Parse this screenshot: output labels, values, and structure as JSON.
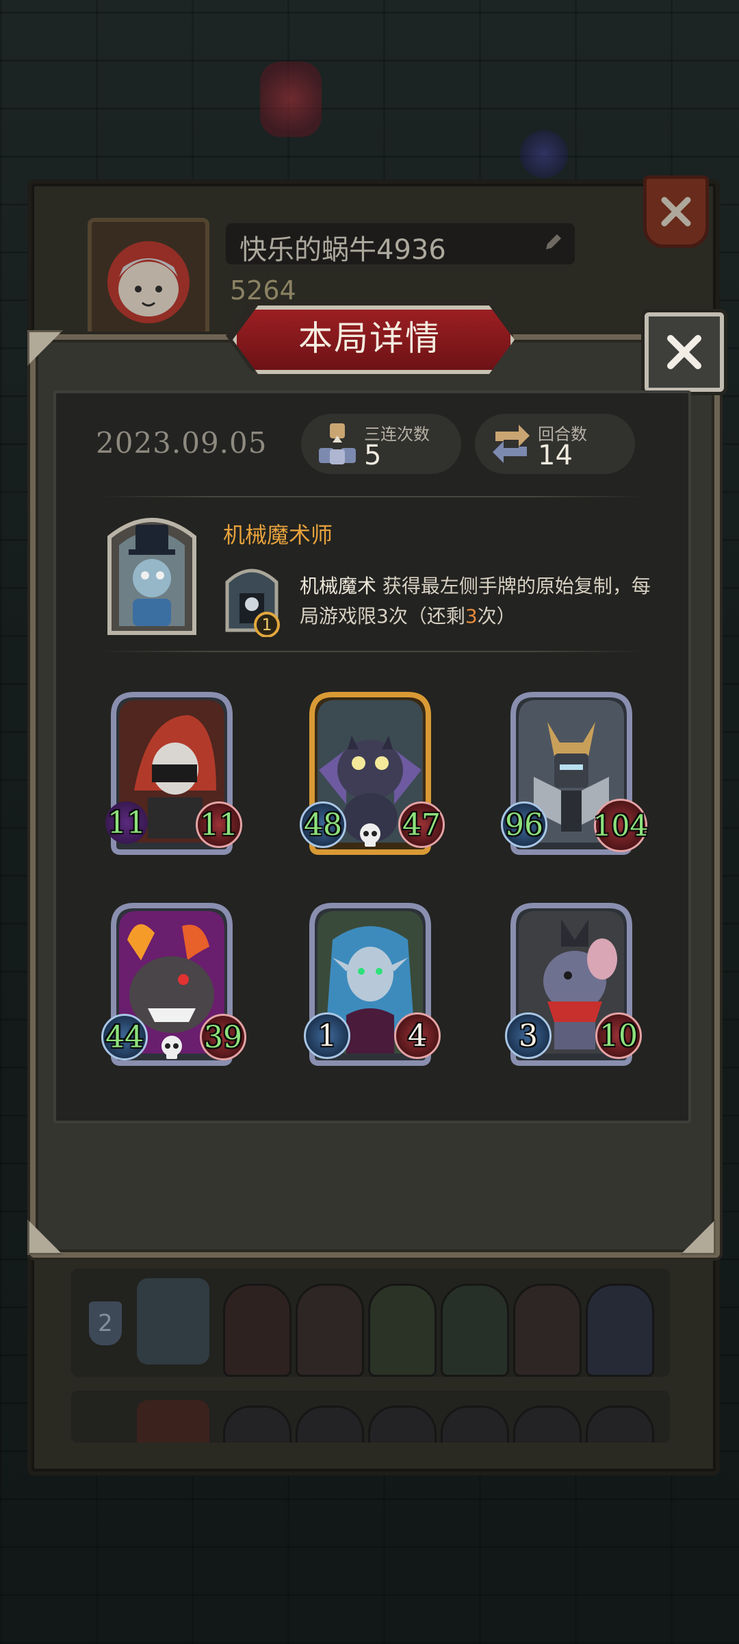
{
  "profile": {
    "name": "快乐的蜗牛4936",
    "coins": "5264"
  },
  "dialog": {
    "title": "本局详情",
    "date": "2023.09.05",
    "stats": [
      {
        "label": "三连次数",
        "value": "5",
        "icon": "triple-cubes-icon"
      },
      {
        "label": "回合数",
        "value": "14",
        "icon": "rounds-arrows-icon"
      }
    ],
    "hero": {
      "name": "机械魔术师",
      "skill_name": "机械魔术",
      "skill_desc": " 获得最左侧手牌的原始复制，每局游戏限3次（还剩",
      "skill_remaining": "3",
      "skill_suffix": "次）",
      "skill_level": "1"
    },
    "cards": [
      {
        "name": "hooded-assassin",
        "attack": "11",
        "health": "11",
        "frame": "silver",
        "skull": false
      },
      {
        "name": "gargoyle",
        "attack": "48",
        "health": "47",
        "frame": "gold",
        "skull": true
      },
      {
        "name": "mech-knight",
        "attack": "96",
        "health": "104",
        "frame": "silver",
        "skull": false
      },
      {
        "name": "flame-demon",
        "attack": "44",
        "health": "39",
        "frame": "purple",
        "skull": true
      },
      {
        "name": "siren",
        "attack": "1",
        "health": "4",
        "frame": "silver",
        "skull": false
      },
      {
        "name": "punk-rat",
        "attack": "3",
        "health": "10",
        "frame": "silver",
        "skull": false
      }
    ]
  },
  "history": {
    "rank": "2"
  },
  "colors": {
    "accent_red": "#9b1f22",
    "hero_name": "#e6a23c",
    "stat_green": "#8de07c",
    "remaining_orange": "#e68a3a"
  }
}
